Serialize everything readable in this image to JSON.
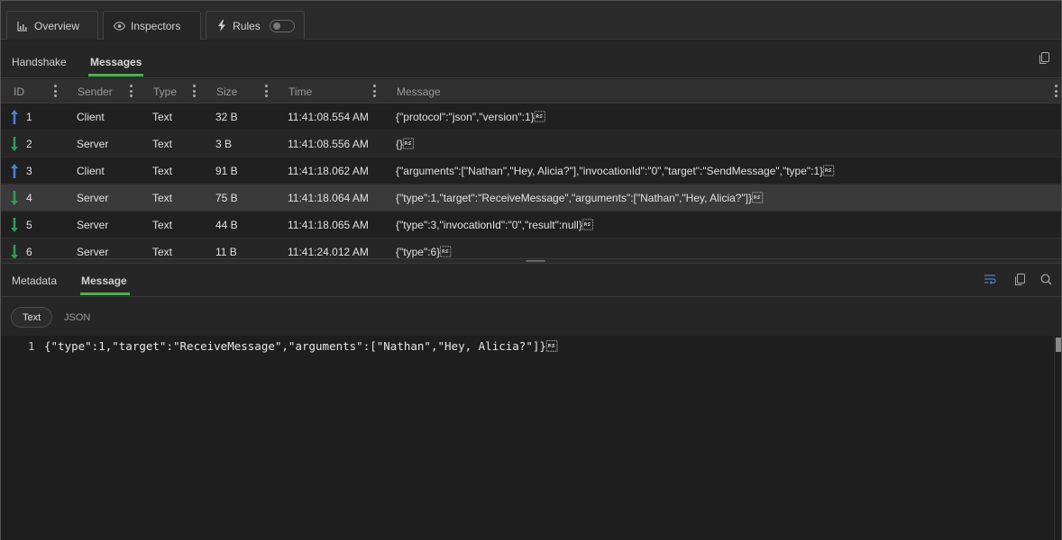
{
  "top_tabs": [
    {
      "label": "Overview",
      "icon": "bar-chart-icon"
    },
    {
      "label": "Inspectors",
      "icon": "eye-icon"
    },
    {
      "label": "Rules",
      "icon": "lightning-icon"
    }
  ],
  "sub_tabs": {
    "handshake": "Handshake",
    "messages": "Messages"
  },
  "table": {
    "columns": [
      "ID",
      "Sender",
      "Type",
      "Size",
      "Time",
      "Message"
    ],
    "rows": [
      {
        "id": "1",
        "direction": "up",
        "sender": "Client",
        "type": "Text",
        "size": "32 B",
        "time": "11:41:08.554 AM",
        "message": "{\"protocol\":\"json\",\"version\":1}\u001e"
      },
      {
        "id": "2",
        "direction": "down",
        "sender": "Server",
        "type": "Text",
        "size": "3 B",
        "time": "11:41:08.556 AM",
        "message": "{}\u001e"
      },
      {
        "id": "3",
        "direction": "up",
        "sender": "Client",
        "type": "Text",
        "size": "91 B",
        "time": "11:41:18.062 AM",
        "message": "{\"arguments\":[\"Nathan\",\"Hey, Alicia?\"],\"invocationId\":\"0\",\"target\":\"SendMessage\",\"type\":1}\u001e"
      },
      {
        "id": "4",
        "direction": "down",
        "sender": "Server",
        "type": "Text",
        "size": "75 B",
        "time": "11:41:18.064 AM",
        "message": "{\"type\":1,\"target\":\"ReceiveMessage\",\"arguments\":[\"Nathan\",\"Hey, Alicia?\"]}\u001e"
      },
      {
        "id": "5",
        "direction": "down",
        "sender": "Server",
        "type": "Text",
        "size": "44 B",
        "time": "11:41:18.065 AM",
        "message": "{\"type\":3,\"invocationId\":\"0\",\"result\":null}\u001e"
      },
      {
        "id": "6",
        "direction": "down",
        "sender": "Server",
        "type": "Text",
        "size": "11 B",
        "time": "11:41:24.012 AM",
        "message": "{\"type\":6}\u001e"
      }
    ]
  },
  "lower_tabs": {
    "metadata": "Metadata",
    "message": "Message"
  },
  "format_tabs": {
    "text": "Text",
    "json": "JSON"
  },
  "editor": {
    "line_number": "1",
    "content": "{\"type\":1,\"target\":\"ReceiveMessage\",\"arguments\":[\"Nathan\",\"Hey, Alicia?\"]}\u001e"
  },
  "colors": {
    "accent": "#4caf50",
    "arrow_up": "#4a7fd6",
    "arrow_down": "#2e9d4f"
  }
}
